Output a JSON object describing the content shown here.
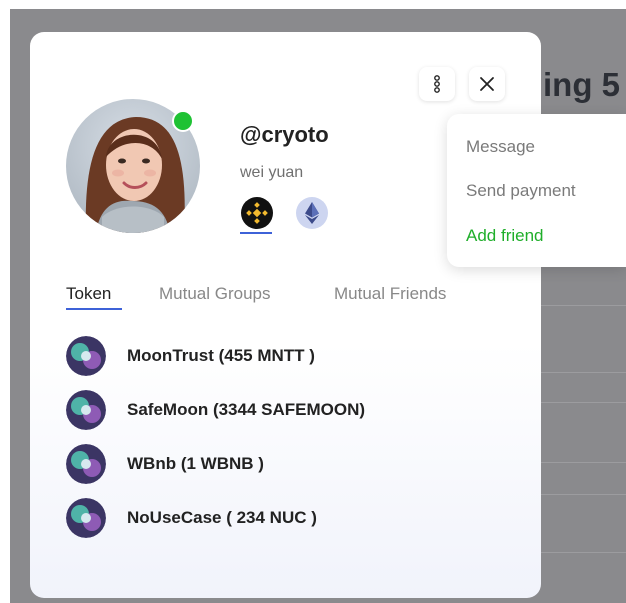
{
  "background": {
    "heading": "ing 5"
  },
  "profile_card": {
    "menu_icon": "vertical-dots-icon",
    "close_icon": "close-icon",
    "username": "@cryoto",
    "display_name": "wei yuan",
    "online_status_color": "#1fc234",
    "chains": [
      {
        "name": "bnb-chain-icon",
        "color": "#f3ba2f"
      },
      {
        "name": "ethereum-icon",
        "color": "#5b6fb8"
      }
    ],
    "tabs": [
      {
        "label": "Token",
        "active": true
      },
      {
        "label": "Mutual Groups",
        "active": false
      },
      {
        "label": "Mutual Friends",
        "active": false
      }
    ],
    "tokens": [
      {
        "label": "MoonTrust (455 MNTT )"
      },
      {
        "label": "SafeMoon (3344 SAFEMOON)"
      },
      {
        "label": "WBnb (1 WBNB )"
      },
      {
        "label": "NoUseCase ( 234 NUC )"
      }
    ]
  },
  "dropdown_menu": {
    "items": [
      {
        "label": "Message",
        "color": "#7a7a7a"
      },
      {
        "label": "Send payment",
        "color": "#7a7a7a"
      },
      {
        "label": "Add friend",
        "color": "#1fae2a"
      }
    ]
  },
  "colors": {
    "accent": "#3e62d8",
    "online": "#1fc234",
    "add_friend": "#1fae2a"
  }
}
